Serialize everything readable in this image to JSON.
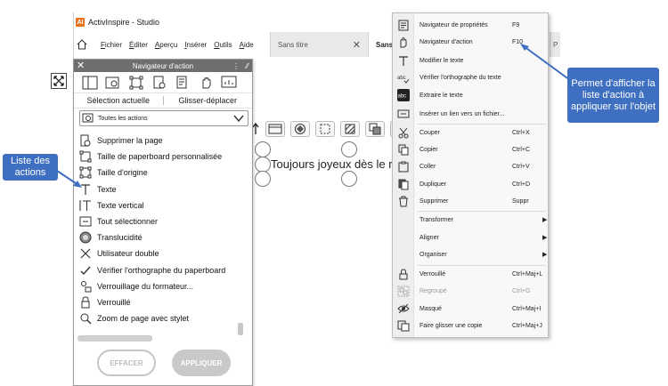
{
  "app": {
    "title": "ActivInspire - Studio",
    "logo": "AI",
    "menu": [
      "Fichier",
      "Éditer",
      "Aperçu",
      "Insérer",
      "Outils",
      "Aide"
    ],
    "tabs": [
      {
        "label": "Sans titre",
        "close": "✕"
      },
      {
        "label": "Sans"
      }
    ],
    "extra_tab_fragment": "P"
  },
  "canvas": {
    "text": "Toujours joyeux dès le r"
  },
  "panel": {
    "title": "Navigateur d'action",
    "close": "✕",
    "grip": "⋮",
    "pin": "⁄⁄",
    "tabs": {
      "current": "Sélection actuelle",
      "drag": "Glisser-déplacer"
    },
    "select_value": "Toutes les actions",
    "items": [
      {
        "label": "Supprimer la page",
        "icon": "delete-page-icon"
      },
      {
        "label": "Taille de paperboard personnalisée",
        "icon": "custom-size-icon"
      },
      {
        "label": "Taille d'origine",
        "icon": "original-size-icon"
      },
      {
        "label": "Texte",
        "icon": "text-icon"
      },
      {
        "label": "Texte vertical",
        "icon": "vertical-text-icon"
      },
      {
        "label": "Tout sélectionner",
        "icon": "select-all-icon"
      },
      {
        "label": "Translucidité",
        "icon": "translucency-icon"
      },
      {
        "label": "Utilisateur double",
        "icon": "dual-user-icon"
      },
      {
        "label": "Vérifier l'orthographe du paperboard",
        "icon": "spellcheck-icon"
      },
      {
        "label": "Verrouillage du formateur...",
        "icon": "teacher-lock-icon"
      },
      {
        "label": "Verrouillé",
        "icon": "lock-icon"
      },
      {
        "label": "Zoom de page avec stylet",
        "icon": "zoom-icon"
      }
    ],
    "buttons": {
      "clear": "EFFACER",
      "apply": "APPLIQUER"
    }
  },
  "context_menu": {
    "items": [
      {
        "label": "Navigateur de propriétés",
        "shortcut": "F9",
        "icon": "property-browser-icon"
      },
      {
        "label": "Navigateur d'action",
        "shortcut": "F10",
        "icon": "action-browser-icon"
      },
      {
        "label": "Modifier le texte",
        "shortcut": "",
        "icon": "text-edit-icon"
      },
      {
        "label": "Vérifier l'orthographe du texte",
        "shortcut": "",
        "icon": "spellcheck-text-icon"
      },
      {
        "label": "Extraire le texte",
        "shortcut": "",
        "icon": "extract-text-icon"
      },
      {
        "label": "Insérer un lien vers un fichier...",
        "shortcut": "",
        "icon": "insert-link-icon"
      },
      {
        "label": "Couper",
        "shortcut": "Ctrl+X",
        "icon": "cut-icon"
      },
      {
        "label": "Copier",
        "shortcut": "Ctrl+C",
        "icon": "copy-icon"
      },
      {
        "label": "Coller",
        "shortcut": "Ctrl+V",
        "icon": "paste-icon"
      },
      {
        "label": "Dupliquer",
        "shortcut": "Ctrl+D",
        "icon": "duplicate-icon"
      },
      {
        "label": "Supprimer",
        "shortcut": "Suppr",
        "icon": "delete-icon"
      },
      {
        "label": "Transformer",
        "shortcut": "",
        "submenu": true
      },
      {
        "label": "Aligner",
        "shortcut": "",
        "submenu": true
      },
      {
        "label": "Organiser",
        "shortcut": "",
        "submenu": true
      },
      {
        "label": "Verrouillé",
        "shortcut": "Ctrl+Maj+L",
        "icon": "lock-icon"
      },
      {
        "label": "Regroupé",
        "shortcut": "Ctrl+G",
        "icon": "group-icon",
        "disabled": true
      },
      {
        "label": "Masqué",
        "shortcut": "Ctrl+Maj+I",
        "icon": "hidden-icon"
      },
      {
        "label": "Faire glisser une copie",
        "shortcut": "Ctrl+Maj+J",
        "icon": "drag-copy-icon"
      }
    ]
  },
  "callouts": {
    "right": "Permet d'afficher la liste d'action à appliquer sur l'objet",
    "left": "Liste des actions"
  },
  "colors": {
    "callout": "#3f6fc1",
    "app_logo": "#e8731c",
    "panel_header": "#6e6e6e"
  }
}
